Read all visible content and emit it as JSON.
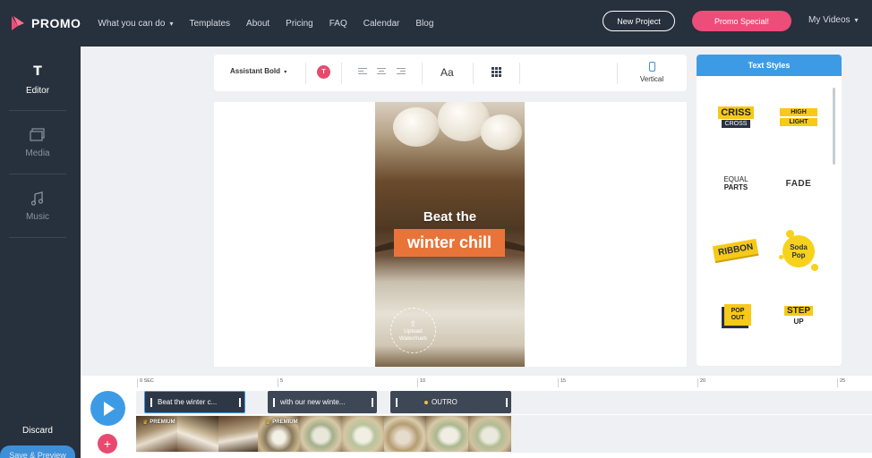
{
  "brand": {
    "name": "PROMO"
  },
  "nav": {
    "items": [
      {
        "label": "What you can do",
        "dropdown": true
      },
      {
        "label": "Templates"
      },
      {
        "label": "About"
      },
      {
        "label": "Pricing"
      },
      {
        "label": "FAQ"
      },
      {
        "label": "Calendar"
      },
      {
        "label": "Blog"
      }
    ],
    "new_project": "New Project",
    "promo_special": "Promo Special!",
    "my_videos": "My Videos"
  },
  "sidebar": {
    "items": [
      {
        "label": "Editor",
        "icon": "text-icon",
        "active": true
      },
      {
        "label": "Media",
        "icon": "media-icon"
      },
      {
        "label": "Music",
        "icon": "music-icon"
      }
    ],
    "discard": "Discard",
    "save_preview": "Save & Preview"
  },
  "toolbar": {
    "font": "Assistant Bold",
    "color_letter": "T",
    "text_size": "Aa",
    "orientation": "Vertical"
  },
  "preview": {
    "line1": "Beat the",
    "line2": "winter chill",
    "watermark": "Upload Watermark"
  },
  "text_styles": {
    "title": "Text Styles",
    "styles": {
      "criss_a": "CRISS",
      "criss_b": "CROSS",
      "high": "HIGH",
      "light": "LIGHT",
      "equal": "EQUAL",
      "parts": "PARTS",
      "fade": "FADE",
      "ribbon": "RIBBON",
      "soda": "Soda",
      "pop": "Pop",
      "pop_out_1": "POP",
      "pop_out_2": "OUT",
      "step": "STEP",
      "up": "UP"
    }
  },
  "timeline": {
    "ticks": [
      "0 SEC",
      "5",
      "10",
      "15",
      "20",
      "25"
    ],
    "clips": [
      {
        "label": "Beat the winter c..."
      },
      {
        "label": "with our new winte..."
      },
      {
        "label": "OUTRO"
      }
    ],
    "premium_label": "PREMIUM"
  },
  "colors": {
    "nav_bg": "#27303d",
    "accent_blue": "#3d9be6",
    "accent_pink": "#ec4d79",
    "overlay_orange": "#e8743a",
    "style_yellow": "#f7c918"
  }
}
